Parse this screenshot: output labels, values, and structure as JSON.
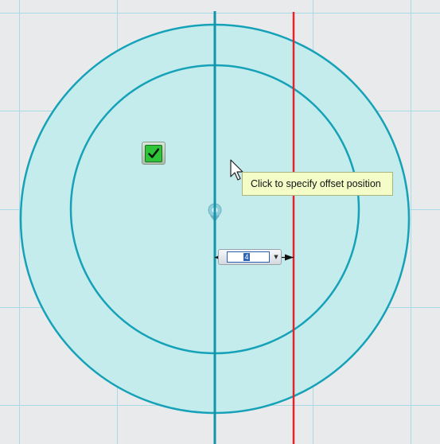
{
  "tooltip": {
    "text": "Click to specify offset position"
  },
  "dimension": {
    "value": "",
    "selected_glyph": "4"
  },
  "icons": {
    "confirm": "checkbox-confirm-icon",
    "cursor": "arrow-cursor-icon",
    "center": "circle-center-snap-icon",
    "dropdown": "triangle-down-icon"
  },
  "colors": {
    "background": "#e9eaec",
    "grid": "#a9dbe6",
    "circle_fill": "#c5ecec",
    "circle_stroke": "#15a2b8",
    "offset_line": "#e3242b",
    "tooltip_bg": "#f4fcc8",
    "check_green": "#2fc33a"
  }
}
